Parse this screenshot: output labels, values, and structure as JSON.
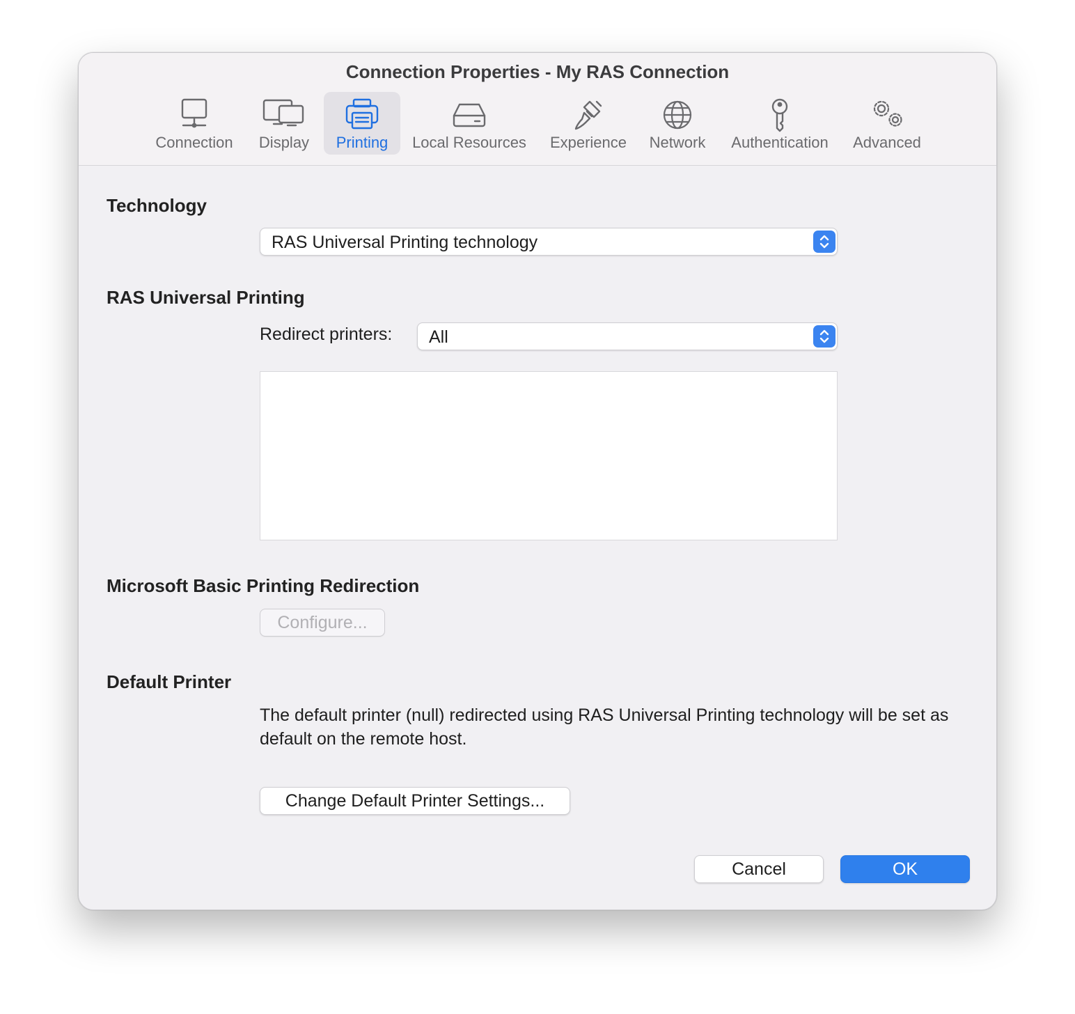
{
  "window": {
    "title": "Connection Properties - My RAS Connection"
  },
  "tabs": [
    {
      "label": "Connection",
      "icon": "monitor-icon",
      "active": false
    },
    {
      "label": "Display",
      "icon": "displays-icon",
      "active": false
    },
    {
      "label": "Printing",
      "icon": "printer-icon",
      "active": true
    },
    {
      "label": "Local Resources",
      "icon": "drive-icon",
      "active": false
    },
    {
      "label": "Experience",
      "icon": "paintbrush-icon",
      "active": false
    },
    {
      "label": "Network",
      "icon": "globe-icon",
      "active": false
    },
    {
      "label": "Authentication",
      "icon": "key-icon",
      "active": false
    },
    {
      "label": "Advanced",
      "icon": "gears-icon",
      "active": false
    }
  ],
  "technology": {
    "heading": "Technology",
    "selected": "RAS Universal Printing technology"
  },
  "universal_printing": {
    "heading": "RAS Universal Printing",
    "redirect_label": "Redirect printers:",
    "redirect_selected": "All",
    "printer_list": []
  },
  "basic_redirection": {
    "heading": "Microsoft Basic Printing Redirection",
    "configure_label": "Configure..."
  },
  "default_printer": {
    "heading": "Default Printer",
    "description": "The default printer (null) redirected using RAS Universal Printing technology will be set as default on the remote host.",
    "change_label": "Change Default Printer Settings..."
  },
  "footer": {
    "cancel_label": "Cancel",
    "ok_label": "OK"
  },
  "colors": {
    "accent": "#2f80ed",
    "active_tab_text": "#1f6fe0",
    "window_background": "#f1f0f3"
  }
}
